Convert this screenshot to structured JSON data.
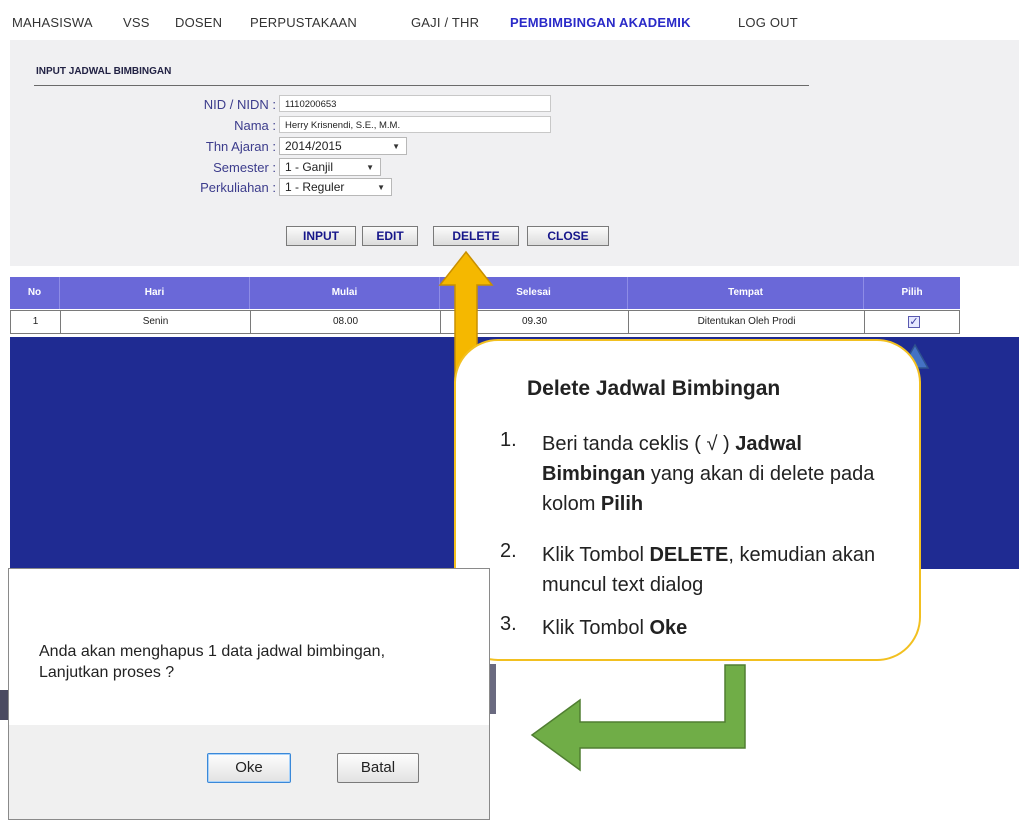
{
  "topnav": {
    "items": [
      "MAHASISWA",
      "VSS",
      "DOSEN",
      "PERPUSTAKAAN",
      "GAJI / THR",
      "PEMBIMBINGAN AKADEMIK",
      "LOG OUT"
    ]
  },
  "form": {
    "title": "INPUT JADWAL BIMBINGAN",
    "nid_label": "NID / NIDN :",
    "nid_value": "1110200653",
    "nama_label": "Nama :",
    "nama_value": "Herry Krisnendi, S.E., M.M.",
    "thn_label": "Thn Ajaran :",
    "thn_value": "2014/2015",
    "semester_label": "Semester :",
    "semester_value": "1 - Ganjil",
    "perkuliahan_label": "Perkuliahan :",
    "perkuliahan_value": "1 - Reguler",
    "buttons": {
      "input": "INPUT",
      "edit": "EDIT",
      "delete": "DELETE",
      "close": "CLOSE"
    }
  },
  "table": {
    "headers": [
      "No",
      "Hari",
      "Mulai",
      "Selesai",
      "Tempat",
      "Pilih"
    ],
    "rows": [
      {
        "no": "1",
        "hari": "Senin",
        "mulai": "08.00",
        "selesai": "09.30",
        "tempat": "Ditentukan Oleh Prodi",
        "pilih_checked": true
      }
    ]
  },
  "callout": {
    "title": "Delete Jadwal Bimbingan",
    "steps": [
      {
        "num": "1.",
        "parts": [
          "Beri tanda ceklis ( √ ) ",
          "Jadwal Bimbingan",
          " yang akan di delete pada kolom ",
          "Pilih"
        ]
      },
      {
        "num": "2.",
        "parts": [
          "Klik Tombol ",
          "DELETE",
          ", kemudian akan muncul text dialog"
        ]
      },
      {
        "num": "3.",
        "parts": [
          "Klik Tombol ",
          "Oke"
        ]
      }
    ]
  },
  "dialog": {
    "line1": "Anda akan menghapus 1 data jadwal bimbingan,",
    "line2": "Lanjutkan proses ?",
    "oke": "Oke",
    "batal": "Batal"
  },
  "colors": {
    "active_nav": "#2a2ac8",
    "table_header": "#6a68d8",
    "work_area": "#1f2b92",
    "arrow_yellow": "#f5b800",
    "arrow_blue": "#4472c4",
    "arrow_green": "#70ad47"
  }
}
